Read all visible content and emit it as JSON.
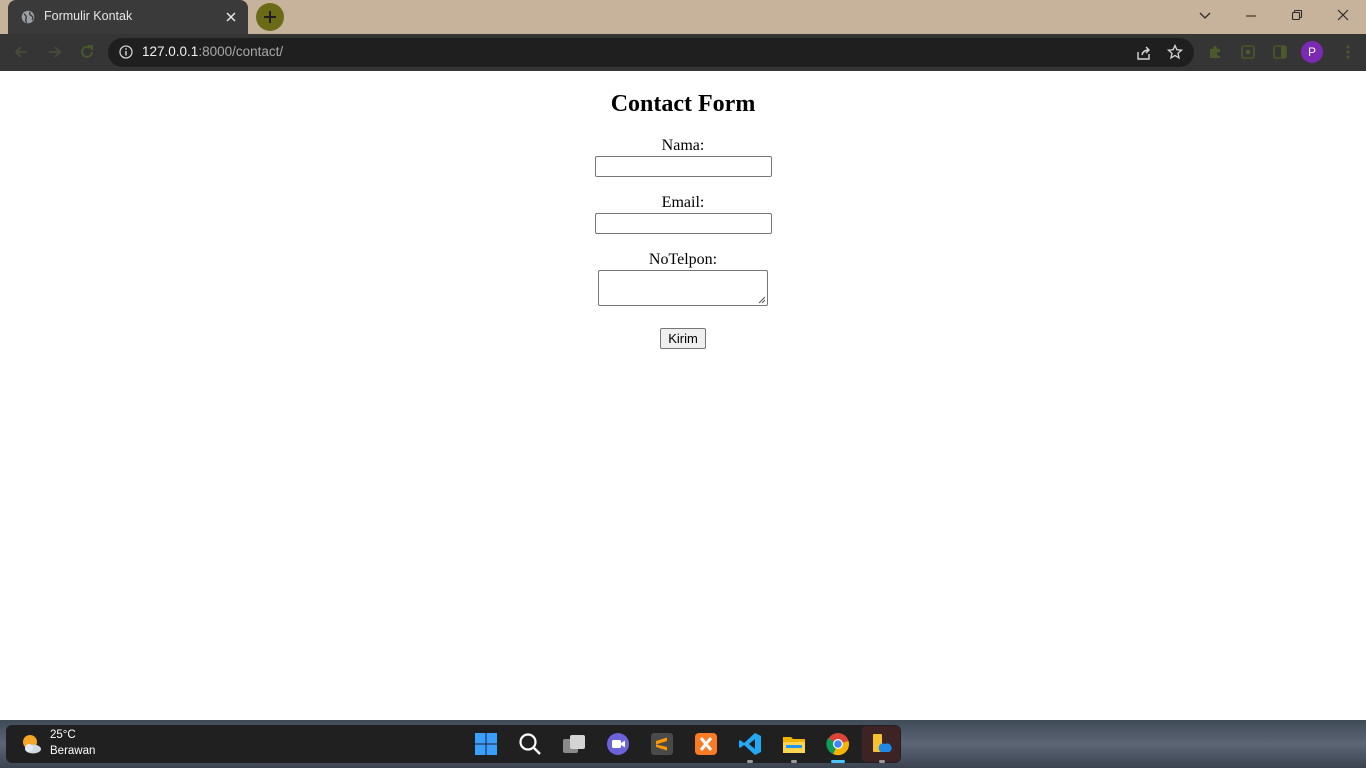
{
  "browser": {
    "tab_title": "Formulir Kontak",
    "url_host": "127.0.0.1",
    "url_rest": ":8000/contact/",
    "profile_initial": "P"
  },
  "form": {
    "heading": "Contact Form",
    "name_label": "Nama:",
    "name_value": "",
    "email_label": "Email:",
    "email_value": "",
    "phone_label": "NoTelpon:",
    "phone_value": "",
    "submit_label": "Kirim"
  },
  "taskbar": {
    "temperature": "25°C",
    "condition": "Berawan",
    "apps": [
      "start-icon",
      "search-icon",
      "task-view-icon",
      "meet-icon",
      "sublime-text-icon",
      "xampp-icon",
      "vscode-icon",
      "file-explorer-icon",
      "chrome-icon",
      "files-app-icon"
    ]
  }
}
